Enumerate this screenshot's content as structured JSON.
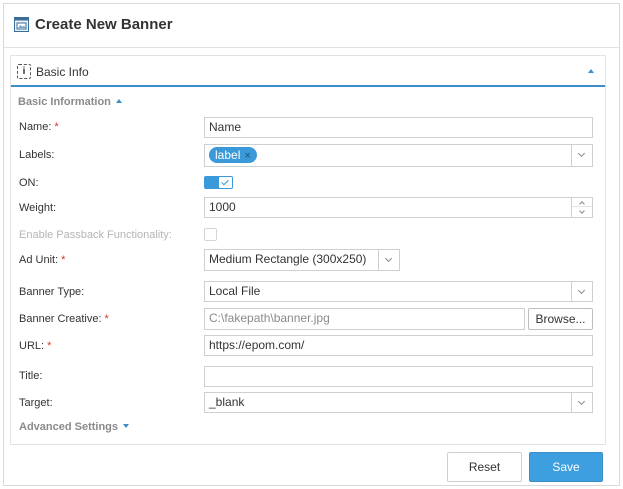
{
  "window": {
    "title": "Create New Banner"
  },
  "panel": {
    "title": "Basic Info",
    "info_icon_glyph": "i"
  },
  "basic_information": {
    "title": "Basic Information"
  },
  "form": {
    "name": {
      "label": "Name:",
      "required": "*",
      "value": "Name"
    },
    "labels": {
      "label": "Labels:",
      "tags": [
        "label"
      ],
      "tag_remove": "×"
    },
    "on": {
      "label": "ON:",
      "checked": true
    },
    "weight": {
      "label": "Weight:",
      "value": "1000"
    },
    "passback": {
      "label": "Enable Passback Functionality:",
      "checked": false,
      "disabled": true
    },
    "ad_unit": {
      "label": "Ad Unit:",
      "required": "*",
      "value": "Medium Rectangle (300x250)"
    },
    "banner_type": {
      "label": "Banner Type:",
      "value": "Local File"
    },
    "banner_creative": {
      "label": "Banner Creative:",
      "required": "*",
      "value": "C:\\fakepath\\banner.jpg",
      "browse_label": "Browse..."
    },
    "url": {
      "label": "URL:",
      "required": "*",
      "value": "https://epom.com/"
    },
    "title": {
      "label": "Title:",
      "value": ""
    },
    "target": {
      "label": "Target:",
      "value": "_blank"
    }
  },
  "advanced_settings": {
    "title": "Advanced Settings"
  },
  "footer": {
    "reset_label": "Reset",
    "save_label": "Save"
  },
  "colors": {
    "accent": "#3a9ad9",
    "required": "#d9342b",
    "primary_button": "#3d9ee0"
  },
  "icons": {
    "window": "banner-window-icon",
    "panel": "info-icon",
    "collapse": "caret-up-icon",
    "expand": "caret-down-icon"
  }
}
